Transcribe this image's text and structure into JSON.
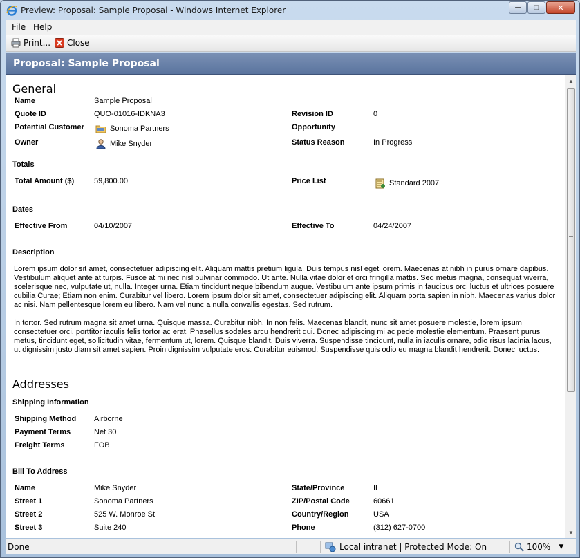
{
  "window": {
    "title": "Preview: Proposal: Sample Proposal - Windows Internet Explorer",
    "minimize": "─",
    "maximize": "□",
    "close": "✕"
  },
  "menu": {
    "file": "File",
    "help": "Help"
  },
  "toolbar": {
    "print_label": "Print...",
    "close_label": "Close"
  },
  "page": {
    "title": "Proposal: Sample Proposal"
  },
  "general": {
    "heading": "General",
    "fields": {
      "name_label": "Name",
      "name_value": "Sample Proposal",
      "quote_label": "Quote ID",
      "quote_value": "QUO-01016-IDKNA3",
      "revision_label": "Revision ID",
      "revision_value": "0",
      "customer_label": "Potential Customer",
      "customer_value": "Sonoma Partners",
      "opportunity_label": "Opportunity",
      "opportunity_value": "",
      "owner_label": "Owner",
      "owner_value": "Mike Snyder",
      "status_label": "Status Reason",
      "status_value": "In Progress"
    }
  },
  "totals": {
    "heading": "Totals",
    "amount_label": "Total Amount ($)",
    "amount_value": "59,800.00",
    "pricelist_label": "Price List",
    "pricelist_value": "Standard 2007"
  },
  "dates": {
    "heading": "Dates",
    "from_label": "Effective From",
    "from_value": "04/10/2007",
    "to_label": "Effective To",
    "to_value": "04/24/2007"
  },
  "description": {
    "heading": "Description",
    "para1": "Lorem ipsum dolor sit amet, consectetuer adipiscing elit. Aliquam mattis pretium ligula. Duis tempus nisl eget lorem. Maecenas at nibh in purus ornare dapibus. Vestibulum aliquet ante at turpis. Fusce at mi nec nisl pulvinar commodo. Ut ante. Nulla vitae dolor et orci fringilla mattis. Sed metus magna, consequat viverra, scelerisque nec, vulputate ut, nulla. Integer urna. Etiam tincidunt neque bibendum augue. Vestibulum ante ipsum primis in faucibus orci luctus et ultrices posuere cubilia Curae; Etiam non enim. Curabitur vel libero. Lorem ipsum dolor sit amet, consectetuer adipiscing elit. Aliquam porta sapien in nibh. Maecenas varius dolor ac nisi. Nam pellentesque lorem eu libero. Nam vel nunc a nulla convallis egestas. Sed rutrum.",
    "para2": "In tortor. Sed rutrum magna sit amet urna. Quisque massa. Curabitur nibh. In non felis. Maecenas blandit, nunc sit amet posuere molestie, lorem ipsum consectetuer orci, porttitor iaculis felis tortor ac erat. Phasellus sodales arcu hendrerit dui. Donec adipiscing mi ac pede molestie elementum. Praesent purus metus, tincidunt eget, sollicitudin vitae, fermentum ut, lorem. Quisque blandit. Duis viverra. Suspendisse tincidunt, nulla in iaculis ornare, odio risus lacinia lacus, ut dignissim justo diam sit amet sapien. Proin dignissim vulputate eros. Curabitur euismod. Suspendisse quis odio eu magna blandit hendrerit. Donec luctus."
  },
  "addresses": {
    "heading": "Addresses",
    "shipping": {
      "heading": "Shipping Information",
      "method_label": "Shipping Method",
      "method_value": "Airborne",
      "payment_label": "Payment Terms",
      "payment_value": "Net 30",
      "freight_label": "Freight Terms",
      "freight_value": "FOB"
    },
    "billto": {
      "heading": "Bill To Address",
      "name_label": "Name",
      "name_value": "Mike Snyder",
      "street1_label": "Street 1",
      "street1_value": "Sonoma Partners",
      "street2_label": "Street 2",
      "street2_value": "525 W. Monroe St",
      "street3_label": "Street 3",
      "street3_value": "Suite 240",
      "state_label": "State/Province",
      "state_value": "IL",
      "zip_label": "ZIP/Postal Code",
      "zip_value": "60661",
      "country_label": "Country/Region",
      "country_value": "USA",
      "phone_label": "Phone",
      "phone_value": "(312) 627-0700"
    }
  },
  "status": {
    "done": "Done",
    "zone": "Local intranet | Protected Mode: On",
    "zoom": "100%"
  },
  "icons": {
    "ie": "ie-logo-icon",
    "print": "printer-icon",
    "close": "close-icon",
    "account": "account-folder-icon",
    "user": "user-icon",
    "pricelist": "price-list-icon",
    "zone": "intranet-zone-icon",
    "zoom": "magnifier-icon"
  }
}
